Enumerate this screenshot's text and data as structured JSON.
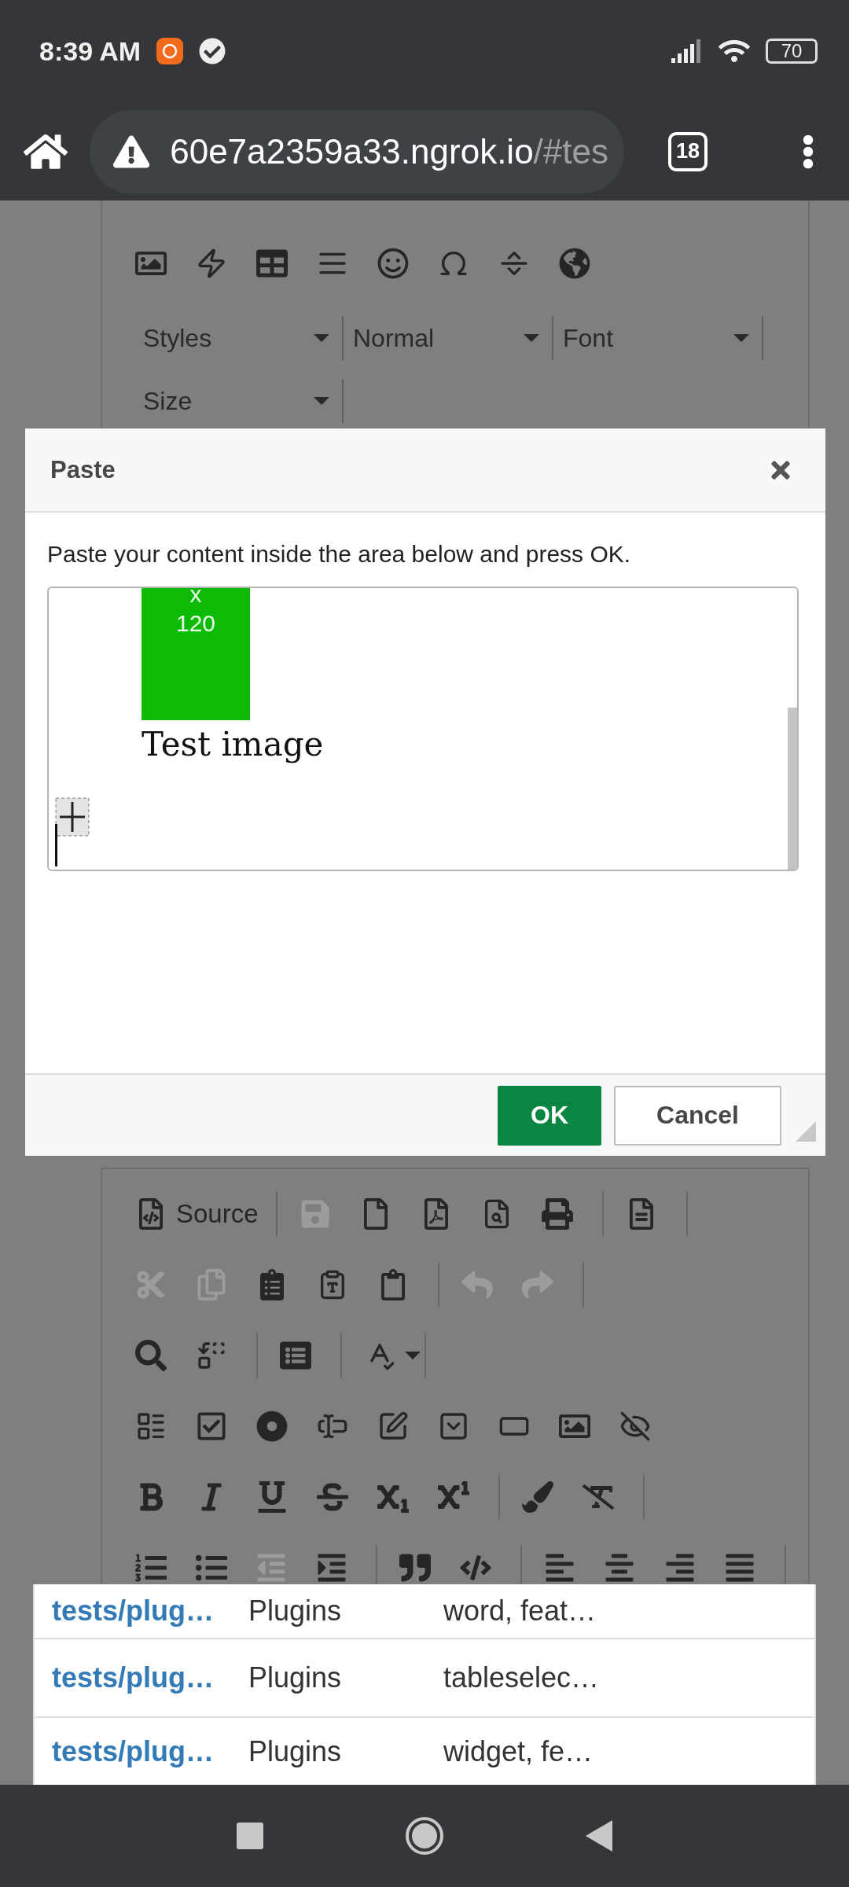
{
  "status_bar": {
    "time": "8:39 AM",
    "battery": "70"
  },
  "browser": {
    "url_host": "60e7a2359a33.ngrok.io",
    "url_path": "/#tes",
    "tab_count": "18"
  },
  "editor_top": {
    "combos": [
      {
        "label": "Styles"
      },
      {
        "label": "Normal"
      },
      {
        "label": "Font"
      },
      {
        "label": "Size"
      }
    ]
  },
  "dialog": {
    "title": "Paste",
    "instruction": "Paste your content inside the area below and press OK.",
    "content": {
      "image_text": [
        "x",
        "120"
      ],
      "caption": "Test image"
    },
    "buttons": [
      {
        "label": "OK",
        "kind": "primary"
      },
      {
        "label": "Cancel",
        "kind": "secondary"
      }
    ]
  },
  "toolbar": {
    "rows": [
      {
        "groups": [
          {
            "items": [
              {
                "label": "Source",
                "disabled": false
              }
            ]
          },
          {
            "items": [
              {
                "disabled": true
              },
              {
                "disabled": false
              },
              {
                "disabled": false
              },
              {
                "disabled": false
              },
              {
                "disabled": false
              }
            ]
          },
          {
            "items": [
              {
                "disabled": false
              }
            ]
          }
        ]
      },
      {
        "groups": [
          {
            "items": [
              {
                "disabled": true
              },
              {
                "disabled": true
              },
              {
                "disabled": false
              },
              {
                "disabled": false
              },
              {
                "disabled": false
              }
            ]
          },
          {
            "items": [
              {
                "disabled": true
              },
              {
                "disabled": true
              }
            ]
          }
        ]
      },
      {
        "groups": [
          {
            "items": [
              {
                "disabled": false
              },
              {
                "disabled": false
              }
            ]
          },
          {
            "items": [
              {
                "disabled": false
              }
            ]
          },
          {
            "items": [
              {
                "disabled": false
              }
            ]
          }
        ]
      },
      {
        "groups": [
          {
            "items": [
              {
                "disabled": false
              },
              {
                "disabled": false
              },
              {
                "disabled": false
              },
              {
                "disabled": false
              },
              {
                "disabled": false
              },
              {
                "disabled": false
              },
              {
                "disabled": false
              },
              {
                "disabled": false
              },
              {
                "disabled": false
              }
            ]
          }
        ]
      },
      {
        "groups": [
          {
            "items": [
              {
                "disabled": false
              },
              {
                "disabled": false
              },
              {
                "disabled": false
              },
              {
                "disabled": false
              },
              {
                "disabled": false
              },
              {
                "disabled": false
              }
            ]
          },
          {
            "items": [
              {
                "disabled": false
              },
              {
                "disabled": false
              }
            ]
          }
        ]
      },
      {
        "groups": [
          {
            "items": [
              {
                "disabled": false
              },
              {
                "disabled": false
              },
              {
                "disabled": true
              },
              {
                "disabled": false
              }
            ]
          },
          {
            "items": [
              {
                "disabled": false
              },
              {
                "disabled": false
              }
            ]
          },
          {
            "items": [
              {
                "disabled": false
              },
              {
                "disabled": false
              },
              {
                "disabled": false
              },
              {
                "disabled": false
              }
            ]
          }
        ]
      }
    ]
  },
  "table": {
    "rows": [
      {
        "cells": [
          "tests/plug…",
          "Plugins",
          "word, feat…"
        ]
      },
      {
        "cells": [
          "tests/plug…",
          "Plugins",
          "tableselec…"
        ]
      },
      {
        "cells": [
          "tests/plug…",
          "Plugins",
          "widget, fe…"
        ]
      }
    ]
  }
}
